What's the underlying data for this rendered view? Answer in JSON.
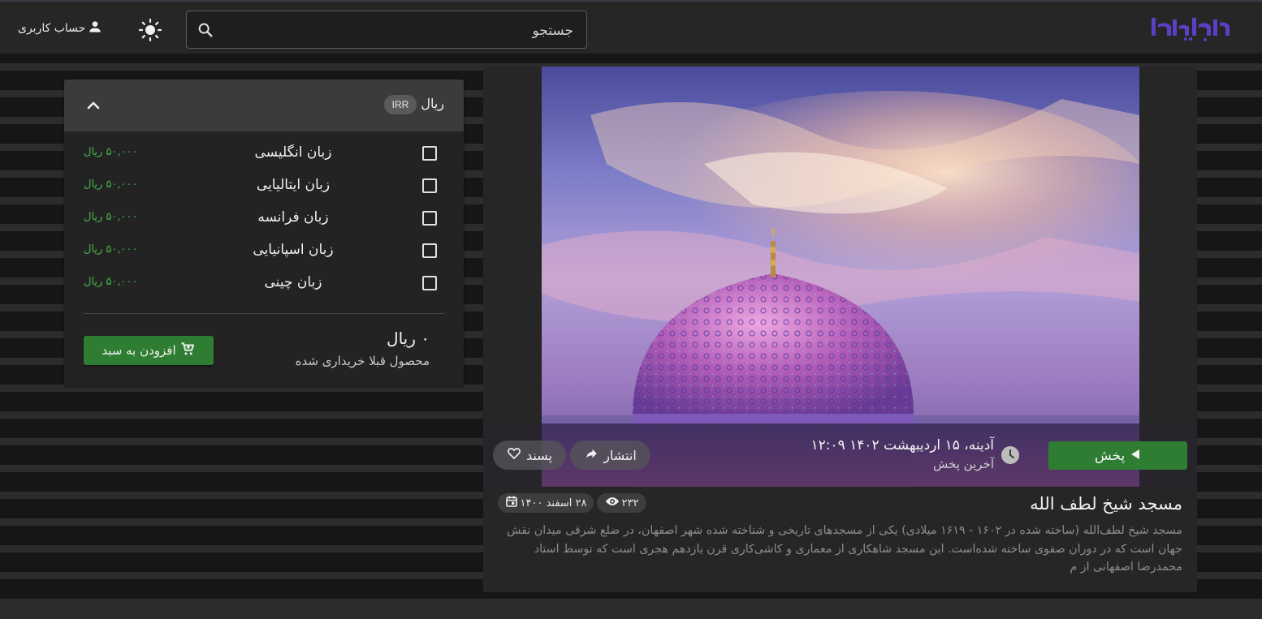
{
  "header": {
    "logo_text": "پارسی‌مدیا",
    "search_placeholder": "جستجو",
    "account_label": "حساب کاربری"
  },
  "purchase": {
    "currency_label": "ریال",
    "currency_code": "IRR",
    "options": [
      {
        "name": "زبان انگلیسی",
        "price": "۵۰,۰۰۰ ریال",
        "checked": false
      },
      {
        "name": "زبان ایتالیایی",
        "price": "۵۰,۰۰۰ ریال",
        "checked": false
      },
      {
        "name": "زبان فرانسه",
        "price": "۵۰,۰۰۰ ریال",
        "checked": false
      },
      {
        "name": "زبان اسپانیایی",
        "price": "۵۰,۰۰۰ ریال",
        "checked": false
      },
      {
        "name": "زبان چینی",
        "price": "۵۰,۰۰۰ ریال",
        "checked": false
      }
    ],
    "total": "۰ ریال",
    "note": "محصول قبلا خریداری شده",
    "add_to_cart": "افزودن به سبد"
  },
  "media": {
    "play_label": "پخش",
    "last_broadcast_date": "آدینه، ۱۵ اردیبهشت ۱۴۰۲ ۱۲:۰۹",
    "last_broadcast_label": "آخرین پخش",
    "share_label": "انتشار",
    "like_label": "پسند",
    "title": "مسجد شیخ لطف الله",
    "views": "۲۳۲",
    "published_date": "۲۸ اسفند ۱۴۰۰",
    "description": "مسجد شیخ لطف‌الله (ساخته شده در ۱۶۰۲ - ۱۶۱۹ میلادی) یکی از مسجدهای تاریخی و شناخته شده شهر اصفهان، در ضلع شرقی میدان نقش جهان است که در دوران صفوی ساخته شده‌است. این مسجد شاهکاری از معماری و کاشی‌کاری قرن یازدهم هجری است که توسط استاد محمدرضا اصفهانی از م"
  },
  "colors": {
    "accent_green": "#2e7d32",
    "price_green": "#45b44a",
    "logo_purple": "#5b3fc4"
  },
  "icons": [
    "search-icon",
    "sun-icon",
    "person-icon",
    "chevron-up-icon",
    "cart-icon",
    "play-icon",
    "clock-icon",
    "share-icon",
    "heart-icon",
    "eye-icon",
    "calendar-icon"
  ]
}
